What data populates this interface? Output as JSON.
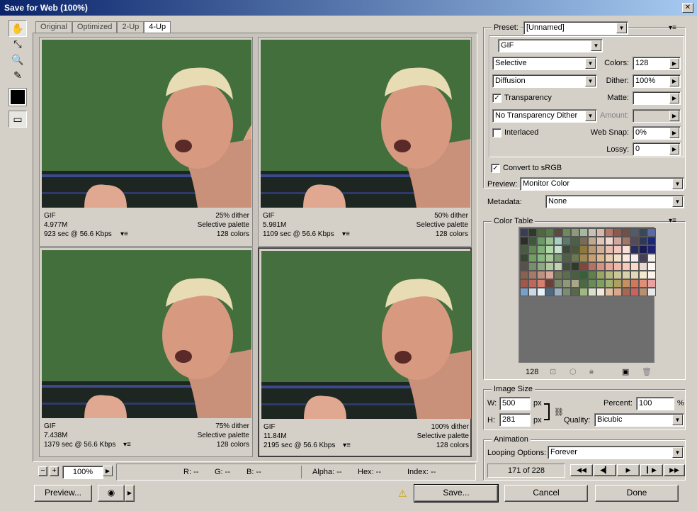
{
  "window": {
    "title": "Save for Web (100%)"
  },
  "tabs": [
    {
      "label": "Original"
    },
    {
      "label": "Optimized"
    },
    {
      "label": "2-Up"
    },
    {
      "label": "4-Up"
    }
  ],
  "panes": [
    {
      "format": "GIF",
      "size": "4.977M",
      "time": "923 sec @ 56.6 Kbps",
      "dither": "25% dither",
      "palette": "Selective palette",
      "colors": "128 colors"
    },
    {
      "format": "GIF",
      "size": "5.981M",
      "time": "1109 sec @ 56.6 Kbps",
      "dither": "50% dither",
      "palette": "Selective palette",
      "colors": "128 colors"
    },
    {
      "format": "GIF",
      "size": "7.438M",
      "time": "1379 sec @ 56.6 Kbps",
      "dither": "75% dither",
      "palette": "Selective palette",
      "colors": "128 colors"
    },
    {
      "format": "GIF",
      "size": "11.84M",
      "time": "2195 sec @ 56.6 Kbps",
      "dither": "100% dither",
      "palette": "Selective palette",
      "colors": "128 colors"
    }
  ],
  "zoom": {
    "value": "100%"
  },
  "status": {
    "r": "R: --",
    "g": "G: --",
    "b": "B: --",
    "alpha": "Alpha: --",
    "hex": "Hex: --",
    "index": "Index: --"
  },
  "settings": {
    "preset_label": "Preset:",
    "preset_value": "[Unnamed]",
    "format": "GIF",
    "palette": "Selective",
    "colors_label": "Colors:",
    "colors": "128",
    "dither_algo": "Diffusion",
    "dither_label": "Dither:",
    "dither": "100%",
    "transparency_label": "Transparency",
    "matte_label": "Matte:",
    "matte": "",
    "trans_dither": "No Transparency Dither",
    "amount_label": "Amount:",
    "amount": "",
    "interlaced_label": "Interlaced",
    "websnap_label": "Web Snap:",
    "websnap": "0%",
    "lossy_label": "Lossy:",
    "lossy": "0",
    "srgb_label": "Convert to sRGB",
    "preview_label": "Preview:",
    "preview_value": "Monitor Color",
    "metadata_label": "Metadata:",
    "metadata_value": "None"
  },
  "color_table": {
    "title": "Color Table",
    "count": "128",
    "colors": [
      "#3a3d55",
      "#2c3a2a",
      "#4c6a3c",
      "#587a48",
      "#5c4a3e",
      "#6c8a5a",
      "#8c9a7a",
      "#a8b8a0",
      "#c8c0b8",
      "#d8b8a8",
      "#b87868",
      "#8c5a4c",
      "#705048",
      "#505a70",
      "#384858",
      "#5a6aa8",
      "#2a3028",
      "#3c5838",
      "#6a9c64",
      "#98c090",
      "#a8d0c0",
      "#5a7a6a",
      "#4a6048",
      "#7a6a58",
      "#c0a890",
      "#e0c8b8",
      "#f0d8d0",
      "#d0a8a0",
      "#a07868",
      "#58485a",
      "#303858",
      "#1a2878",
      "#485a40",
      "#608850",
      "#80b078",
      "#b0d8a8",
      "#c8e0d0",
      "#3c4838",
      "#4a5838",
      "#90783c",
      "#b89870",
      "#d0b098",
      "#e8c0b0",
      "#f0c8c0",
      "#f8e0d8",
      "#282c60",
      "#181c50",
      "#202070",
      "#384830",
      "#70a060",
      "#88b880",
      "#a8c898",
      "#7c9c70",
      "#506048",
      "#6c7850",
      "#a08850",
      "#c8a070",
      "#e0b890",
      "#e8d0b0",
      "#f0e0c8",
      "#fce8e0",
      "#f8f0f0",
      "#484058",
      "#f4f0e8",
      "#5a5048",
      "#789068",
      "#90a880",
      "#b0c8a0",
      "#c0d0b0",
      "#405038",
      "#2c3c28",
      "#804838",
      "#b87060",
      "#d89080",
      "#e8a898",
      "#f0b8a8",
      "#f8c8b8",
      "#fcd8c8",
      "#e8d8d0",
      "#fff8f4",
      "#8a6050",
      "#a87868",
      "#c09080",
      "#d8a898",
      "#70785a",
      "#587050",
      "#486040",
      "#386038",
      "#608048",
      "#98a860",
      "#b8b880",
      "#c8c898",
      "#d8d0a8",
      "#e0d8b8",
      "#f4e8d0",
      "#fcf4e8",
      "#a05848",
      "#c06858",
      "#d88070",
      "#6a4038",
      "#7a8868",
      "#909878",
      "#a8a888",
      "#4c6844",
      "#688c58",
      "#80a060",
      "#a0b070",
      "#b0a060",
      "#c89060",
      "#d07858",
      "#e09078",
      "#e8a0a0",
      "#78a0c8",
      "#c8d8e8",
      "#e8f0f8",
      "#506880",
      "#9ab0c0",
      "#7c8c70",
      "#586848",
      "#a0b880",
      "#d8e0c8",
      "#f0e8d8",
      "#e0c0a0",
      "#d8a888",
      "#a86850",
      "#d06060",
      "#b89070",
      "#e8e8e8"
    ]
  },
  "image_size": {
    "title": "Image Size",
    "w_label": "W:",
    "w": "500",
    "h_label": "H:",
    "h": "281",
    "unit": "px",
    "percent_label": "Percent:",
    "percent": "100",
    "percent_unit": "%",
    "quality_label": "Quality:",
    "quality": "Bicubic"
  },
  "animation": {
    "title": "Animation",
    "looping_label": "Looping Options:",
    "looping": "Forever",
    "frame": "171 of 228"
  },
  "buttons": {
    "preview": "Preview...",
    "save": "Save...",
    "cancel": "Cancel",
    "done": "Done"
  }
}
